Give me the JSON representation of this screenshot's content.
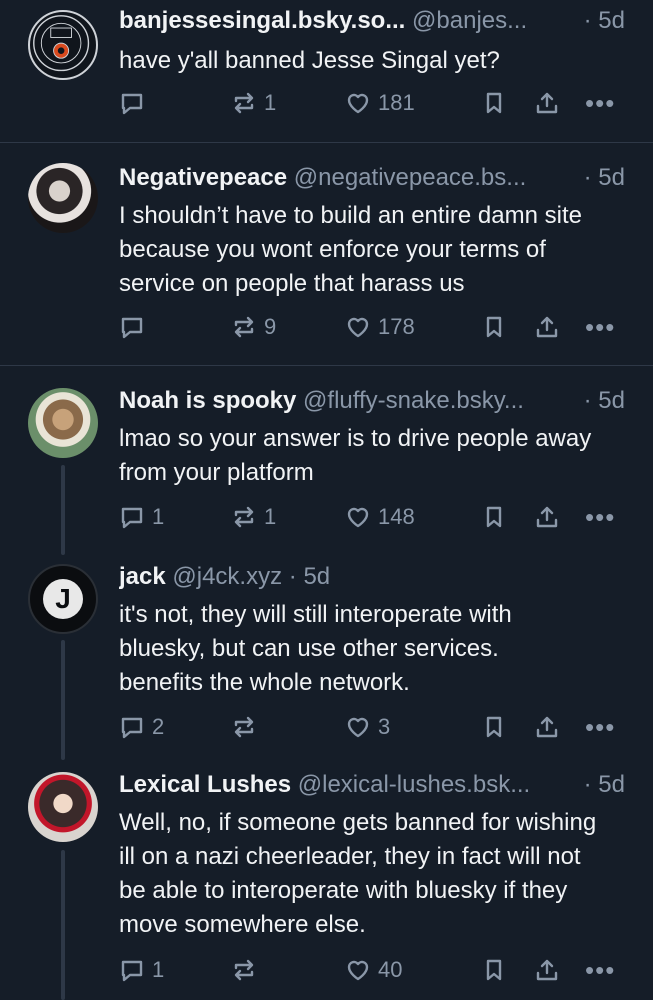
{
  "posts": [
    {
      "display_name": "banjessesingal.bsky.so...",
      "handle": "@banjes...",
      "age": "· 5d",
      "text": "have y'all banned Jesse Singal yet?",
      "avatar_text": "MCR",
      "avatar_ring_top": "MARTIAN",
      "avatar_ring_bottom": "CONGRESSIONAL REPUBLIC",
      "replies": "",
      "reposts": "1",
      "likes": "181"
    },
    {
      "display_name": "Negativepeace",
      "handle": "@negativepeace.bs...",
      "age": "· 5d",
      "text": "I shouldn’t have to build an entire damn site because you wont enforce your terms of service on people that harass us",
      "replies": "",
      "reposts": "9",
      "likes": "178"
    },
    {
      "display_name": "Noah is spooky",
      "handle": "@fluffy-snake.bsky...",
      "age": "· 5d",
      "text": "lmao so your answer is to drive people away from your platform",
      "replies": "1",
      "reposts": "1",
      "likes": "148"
    },
    {
      "display_name": "jack",
      "handle": "@j4ck.xyz",
      "age": "· 5d",
      "text": "it's not, they will still interoperate with bluesky, but can use other services. benefits the whole network.",
      "avatar_letter": "J",
      "replies": "2",
      "reposts": "",
      "likes": "3"
    },
    {
      "display_name": "Lexical Lushes",
      "handle": "@lexical-lushes.bsk...",
      "age": "· 5d",
      "text": "Well, no, if someone gets banned for wishing ill on a nazi cheerleader, they in fact will not be able to interoperate with bluesky if they move somewhere else.",
      "replies": "1",
      "reposts": "",
      "likes": "40"
    }
  ],
  "more_label": "•••",
  "colors": {
    "background": "#151d28",
    "muted": "#8a97a8",
    "separator": "#2e3847"
  }
}
